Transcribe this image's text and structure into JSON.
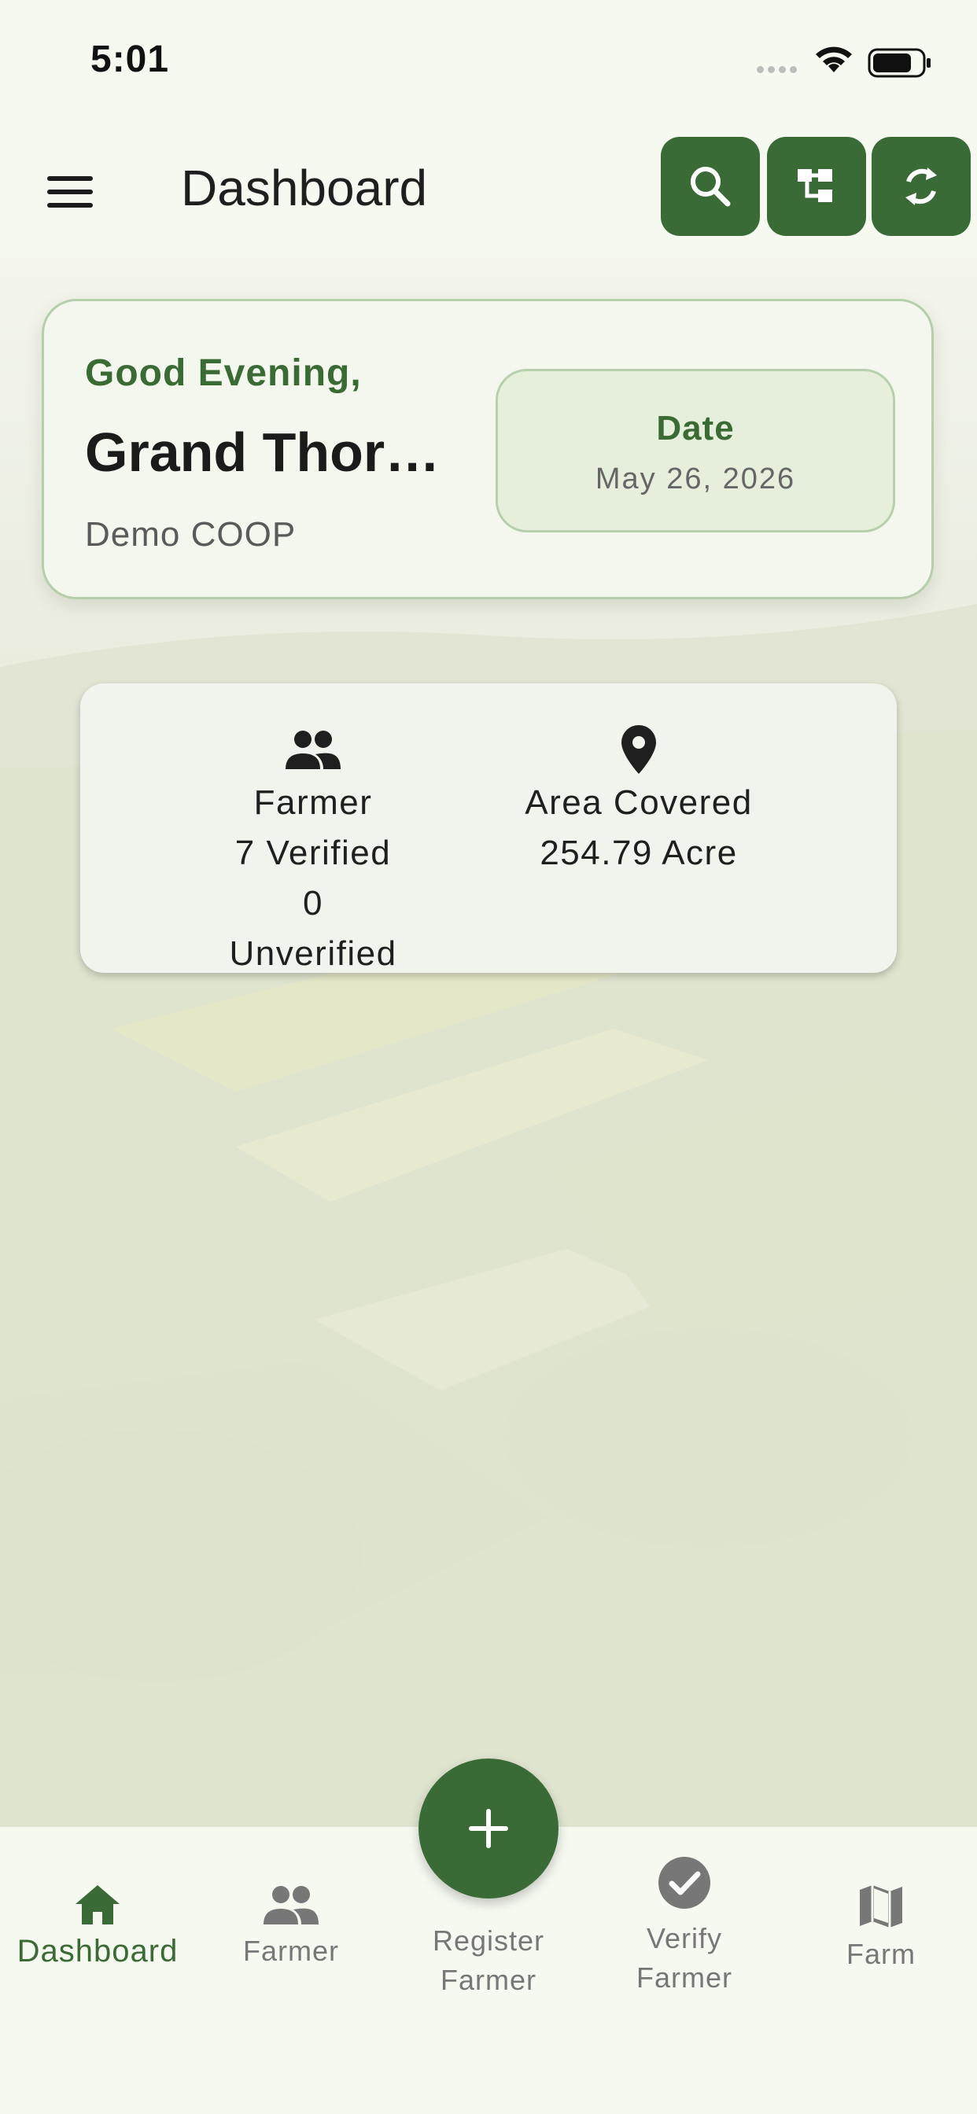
{
  "status_bar": {
    "time": "5:01"
  },
  "app_bar": {
    "title": "Dashboard",
    "icons": [
      "menu-icon",
      "search-icon",
      "hierarchy-icon",
      "sync-icon"
    ]
  },
  "greeting_card": {
    "greeting": "Good Evening,",
    "user_name": "Grand Thor…",
    "organization": "Demo COOP",
    "date_label": "Date",
    "date_value": "May 26, 2026"
  },
  "stats": {
    "farmer": {
      "icon": "people-icon",
      "label": "Farmer",
      "verified": "7 Verified",
      "unverified": "0 Unverified"
    },
    "area": {
      "icon": "location-pin-icon",
      "label": "Area Covered",
      "value": "254.79 Acre"
    }
  },
  "bottom_nav": {
    "items": [
      {
        "label": "Dashboard",
        "icon": "home-icon",
        "active": true
      },
      {
        "label": "Farmer",
        "icon": "people-icon",
        "active": false
      },
      {
        "label_line1": "Register",
        "label_line2": "Farmer",
        "icon": "plus-icon",
        "active": false
      },
      {
        "label_line1": "Verify",
        "label_line2": "Farmer",
        "icon": "check-circle-icon",
        "active": false
      },
      {
        "label": "Farm",
        "icon": "map-icon",
        "active": false
      }
    ]
  },
  "colors": {
    "primary": "#3a6b37",
    "background": "#f6f9f0",
    "card_border": "#b5cfac",
    "date_box": "#e6eedc"
  }
}
